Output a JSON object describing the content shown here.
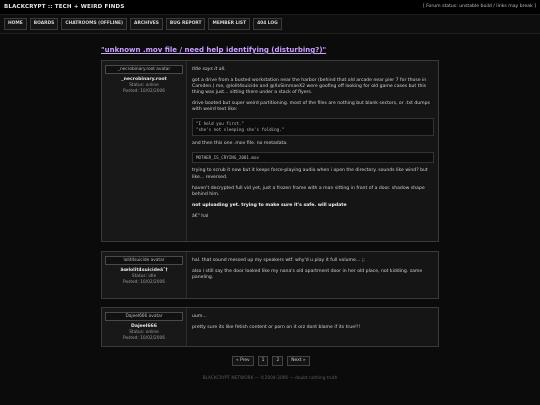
{
  "header": {
    "site_title": "BLACKCRYPT :: TECH + WEIRD FINDS",
    "forum_status": "[ Forum status: unstable build / links may break ]"
  },
  "nav": [
    "HOME",
    "BOARDS",
    "CHATROOMS (offline)",
    "ARCHIVES",
    "BUG REPORT",
    "MEMBER LIST",
    "404 LOG"
  ],
  "thread": {
    "title": "\"unknown .mov file / need help identifying (disturbing?)\""
  },
  "posts": [
    {
      "avatar_alt": "_necrobinary.root avatar",
      "username": "_necrobinary.root",
      "status": "Status: online",
      "posted": "Posted: 10/02/2006",
      "p1": "title says it all.",
      "p2": "got a drive from a busted workstation near the harbor (behind that old arcade near pier 7 for those in Camden.) me, @lolit4suicide and @XxSimmaeX2 were goofing off looking for old game cases but this thing was just... sitting there under a stack of flyers.",
      "p3": "drive booted but super weird partitioning. most of the files are nothing but blank sectors, or .txt dumps with weird text like:",
      "code1": "\"I held you first.\"",
      "code2": "\"she's not sleeping she's folding.\"",
      "p4": "and then this one .mov file. no metadata.",
      "code3": "MOTHER_IS_CRYING_2001.mov",
      "p5": "trying to scrub it now but it keeps force-playing audio when i open the directory. sounds like wind? but like... reversed.",
      "p6": "haven't decrypted full vid yet, just a frozen frame with a man sitting in front of a door. shadow shape behind him.",
      "p7": "not uploading yet. trying to make sure it's safe. will update",
      "p8": "â€\" hal"
    },
    {
      "avatar_alt": "lolit4suicide avatar",
      "username": "âœ­lolit4suicideâ˜†",
      "status": "Status: idle",
      "posted": "Posted: 10/02/2006",
      "p1": "hal. that sound messed up my speakers wtf. why'd u play it full volume... ;;",
      "p2": "also i still say the door looked like my nana's old apartment door in her old place, not kidding. same paneling."
    },
    {
      "avatar_alt": "Dajeel666 avatar",
      "username": "Dajeel666",
      "status": "Status: online",
      "posted": "Posted: 10/02/2006",
      "p1": "uum...",
      "p2": "pretty sure its like fetish content or porn on it orz dont blame if its true!!!"
    }
  ],
  "pager": {
    "prev": "« Prev",
    "p1": "1",
    "p2": "2",
    "next": "Next »"
  },
  "footer": "BLACKCRYPT NETWORK — ©2004-2006 — doubt nothing truth"
}
